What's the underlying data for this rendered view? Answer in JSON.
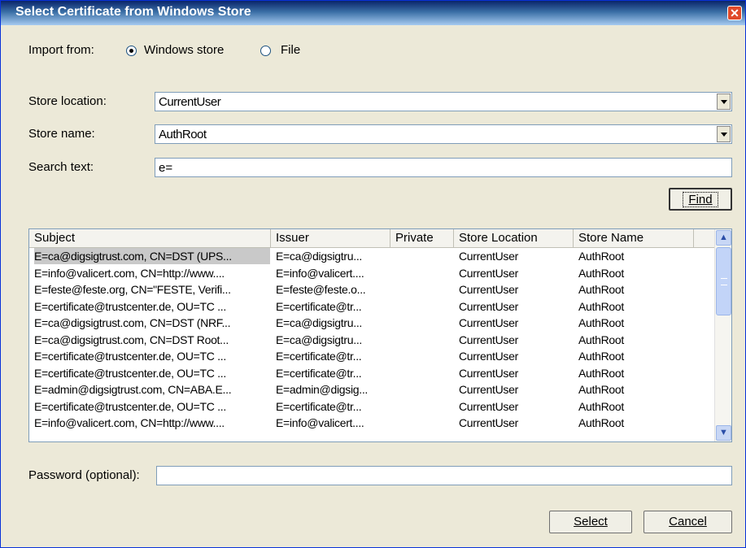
{
  "window": {
    "title": "Select Certificate from Windows Store",
    "close_glyph": "✕"
  },
  "import": {
    "label": "Import from:",
    "option_store": "Windows store",
    "option_file": "File",
    "selected": "Windows store"
  },
  "store_location": {
    "label": "Store location:",
    "value": "CurrentUser"
  },
  "store_name": {
    "label": "Store name:",
    "value": "AuthRoot"
  },
  "search": {
    "label": "Search text:",
    "value": "e="
  },
  "find_button": {
    "label": "Find"
  },
  "table": {
    "columns": [
      "Subject",
      "Issuer",
      "Private",
      "Store Location",
      "Store Name"
    ],
    "rows": [
      [
        "E=ca@digsigtrust.com, CN=DST (UPS...",
        "E=ca@digsigtru...",
        "",
        "CurrentUser",
        "AuthRoot"
      ],
      [
        "E=info@valicert.com, CN=http://www....",
        "E=info@valicert....",
        "",
        "CurrentUser",
        "AuthRoot"
      ],
      [
        "E=feste@feste.org, CN=\"FESTE, Verifi...",
        "E=feste@feste.o...",
        "",
        "CurrentUser",
        "AuthRoot"
      ],
      [
        "E=certificate@trustcenter.de, OU=TC ...",
        "E=certificate@tr...",
        "",
        "CurrentUser",
        "AuthRoot"
      ],
      [
        "E=ca@digsigtrust.com, CN=DST (NRF...",
        "E=ca@digsigtru...",
        "",
        "CurrentUser",
        "AuthRoot"
      ],
      [
        "E=ca@digsigtrust.com, CN=DST Root...",
        "E=ca@digsigtru...",
        "",
        "CurrentUser",
        "AuthRoot"
      ],
      [
        "E=certificate@trustcenter.de, OU=TC ...",
        "E=certificate@tr...",
        "",
        "CurrentUser",
        "AuthRoot"
      ],
      [
        "E=certificate@trustcenter.de, OU=TC ...",
        "E=certificate@tr...",
        "",
        "CurrentUser",
        "AuthRoot"
      ],
      [
        "E=admin@digsigtrust.com, CN=ABA.E...",
        "E=admin@digsig...",
        "",
        "CurrentUser",
        "AuthRoot"
      ],
      [
        "E=certificate@trustcenter.de, OU=TC ...",
        "E=certificate@tr...",
        "",
        "CurrentUser",
        "AuthRoot"
      ],
      [
        "E=info@valicert.com, CN=http://www....",
        "E=info@valicert....",
        "",
        "CurrentUser",
        "AuthRoot"
      ]
    ],
    "selected_row": 0
  },
  "password": {
    "label": "Password (optional):",
    "value": ""
  },
  "select_button": {
    "label": "Select"
  },
  "cancel_button": {
    "label": "Cancel"
  },
  "icons": {
    "scroll_up": "▲",
    "scroll_down": "▼"
  }
}
